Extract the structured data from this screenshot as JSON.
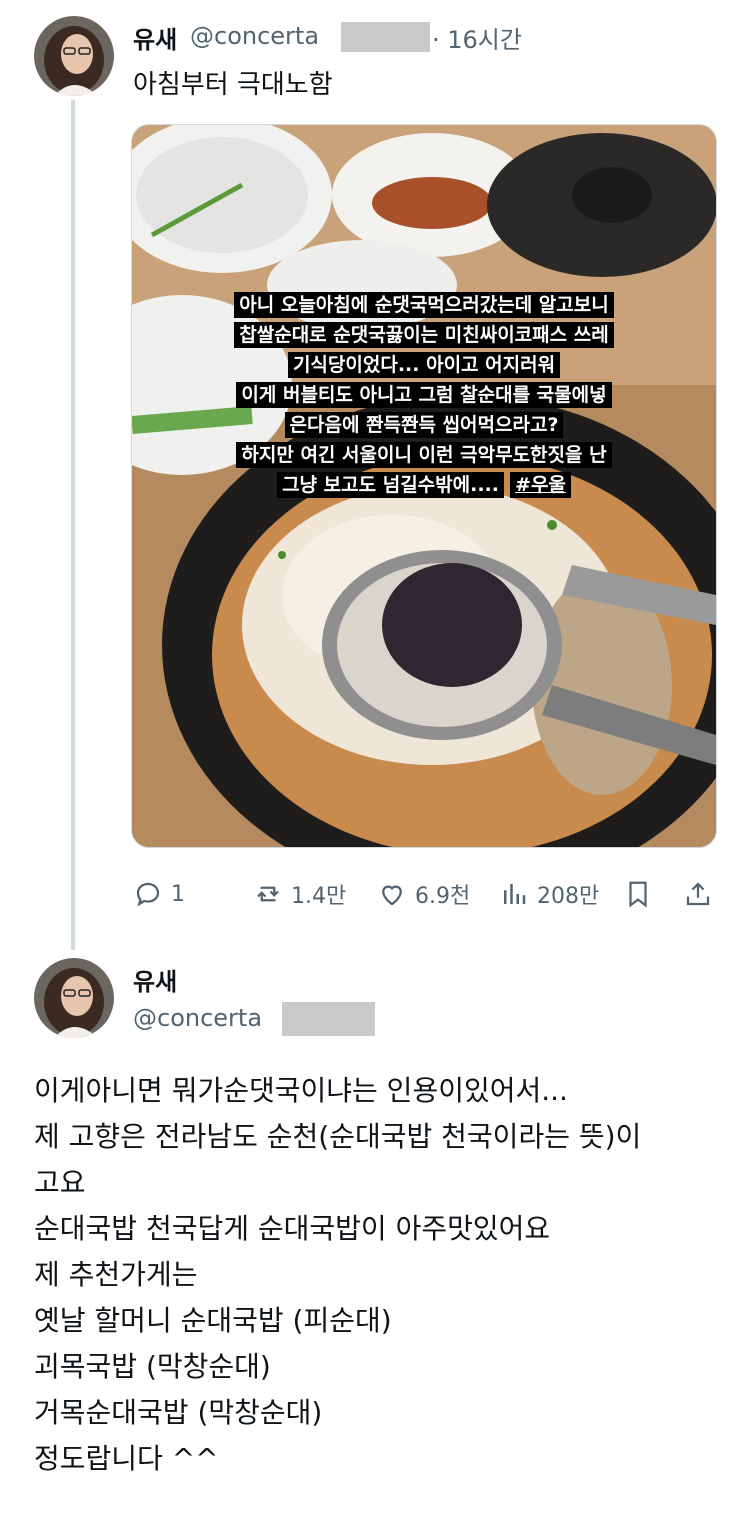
{
  "tweet1": {
    "author_name": "유새",
    "author_handle": "@concerta",
    "time": "· 16시간",
    "text": "아침부터 극대노함",
    "media_caption_lines": [
      "아니 오늘아침에 순댓국먹으러갔는데 알고보니",
      "찹쌀순대로 순댓국끓이는 미친싸이코패스 쓰레",
      "기식당이었다... 아이고 어지러워",
      "이게 버블티도 아니고 그럼 찰순대를 국물에넣",
      "은다음에 쫜득쫜득 씹어먹으라고?",
      "하지만 여긴 서울이니 이런 극악무도한짓을 난",
      "그냥 보고도 넘길수밖에....",
      "#우울"
    ],
    "actions": {
      "replies": "1",
      "reposts": "1.4만",
      "likes": "6.9천",
      "views": "208만"
    }
  },
  "tweet2": {
    "author_name": "유새",
    "author_handle": "@concerta",
    "text": "이게아니면 뭐가순댓국이냐는 인용이있어서...\n제 고향은 전라남도 순천(순대국밥 천국이라는 뜻)이\n고요\n순대국밥 천국답게 순대국밥이 아주맛있어요\n제 추천가게는\n옛날 할머니 순대국밥 (피순대)\n괴목국밥 (막창순대)\n거목순대국밥 (막창순대)\n정도랍니다 ^^"
  },
  "colors": {
    "text": "#0f1419",
    "secondary": "#536471",
    "thread_line": "#cfd9de",
    "caption_bg": "#000000"
  },
  "icons": [
    "reply-icon",
    "repost-icon",
    "like-icon",
    "views-icon",
    "bookmark-icon",
    "share-icon"
  ]
}
